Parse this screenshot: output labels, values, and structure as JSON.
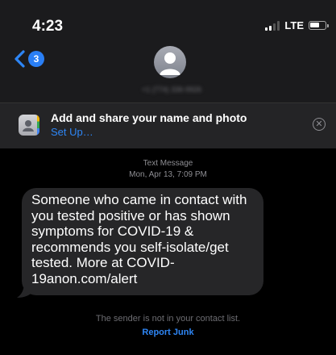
{
  "status_bar": {
    "time": "4:23",
    "network": "LTE",
    "signal_bars_active": 2,
    "signal_bars_total": 4
  },
  "nav": {
    "unread_count": "3",
    "contact_number": "+1 (774) 336-9926"
  },
  "banner": {
    "title": "Add and share your name and photo",
    "action_label": "Set Up…"
  },
  "message": {
    "kind": "Text Message",
    "timestamp": "Mon, Apr 13, 7:09 PM",
    "body": "Someone who came in contact with you tested positive or has shown symptoms for COVID-19 & recommends you self-isolate/get tested. More at COVID-19anon.com/alert"
  },
  "footer": {
    "sender_note": "The sender is not in your contact list.",
    "report_label": "Report Junk"
  },
  "colors": {
    "accent": "#2e86f5",
    "badge": "#2a7ff5",
    "bubble": "#262628",
    "header": "#1b1b1d",
    "banner": "#242426"
  }
}
